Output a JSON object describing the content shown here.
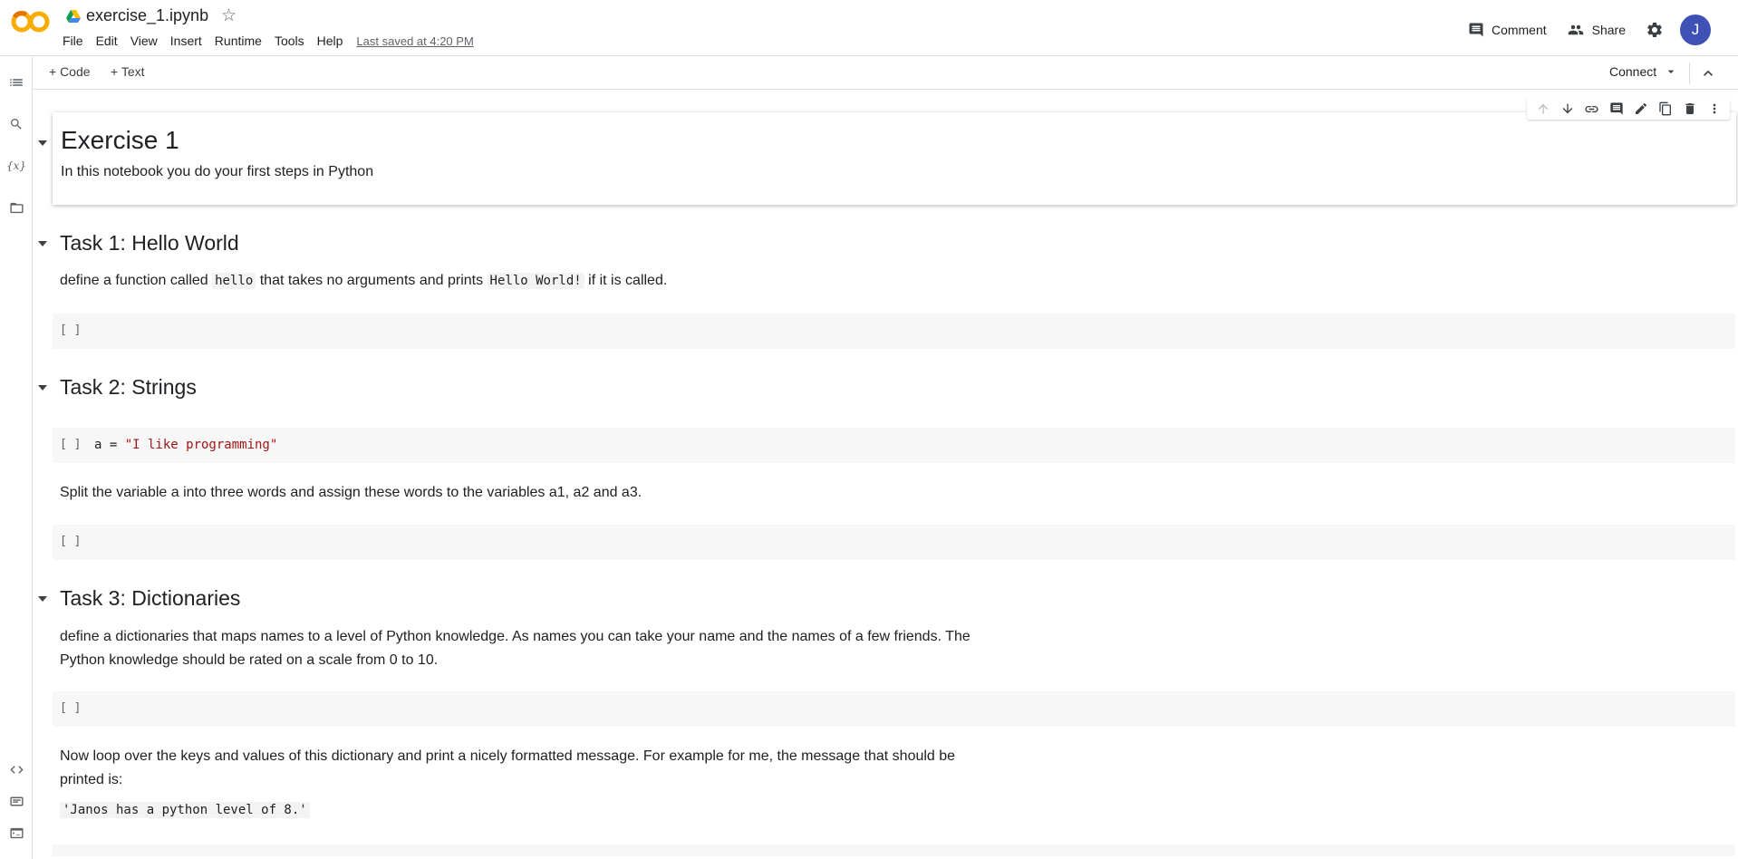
{
  "header": {
    "title": "exercise_1.ipynb",
    "menu": [
      "File",
      "Edit",
      "View",
      "Insert",
      "Runtime",
      "Tools",
      "Help"
    ],
    "last_saved": "Last saved at 4:20 PM",
    "comment_label": "Comment",
    "share_label": "Share",
    "avatar_initial": "J",
    "logo_text": "CO",
    "accent_color": "#f9ab00",
    "avatar_color": "#3f51b5"
  },
  "toolbar": {
    "add_code": "+ Code",
    "add_text": "+ Text",
    "connect": "Connect"
  },
  "left_rail": {
    "icons": [
      "table-of-contents-icon",
      "search-icon",
      "variables-icon",
      "files-icon",
      "code-snippets-icon",
      "command-palette-icon",
      "terminal-icon"
    ],
    "variables_text": "{x}"
  },
  "cell_toolbar": {
    "icons": [
      "move-up-icon",
      "move-down-icon",
      "link-icon",
      "comment-icon",
      "edit-icon",
      "mirror-cell-icon",
      "delete-icon",
      "more-icon"
    ]
  },
  "notebook": {
    "exercise": {
      "title": "Exercise 1",
      "text": "In this notebook you do your first steps in Python"
    },
    "task1": {
      "title": "Task 1: Hello World",
      "text_before": "define a function called ",
      "code1": "hello",
      "text_middle": " that takes no arguments and prints ",
      "code2": "Hello World!",
      "text_after": " if it is called.",
      "code_cell": ""
    },
    "task2": {
      "title": "Task 2: Strings",
      "code_var": "a = ",
      "code_str": "\"I like programming\"",
      "text": "Split the variable a into three words and assign these words to the variables a1, a2 and a3."
    },
    "task3": {
      "title": "Task 3: Dictionaries",
      "text1_line1": "define a dictionaries that maps names to a level of Python knowledge. As names you can take your name and the names of a few friends. The",
      "text1_line2": "Python knowledge should be rated on a scale from 0 to 10.",
      "text2_line1": "Now loop over the keys and values of this dictionary and print a nicely formatted message. For example for me, the message that should be",
      "text2_line2": "printed is:",
      "example": "'Janos has a python level of 8.'"
    },
    "run_bracket": "[ ]"
  }
}
